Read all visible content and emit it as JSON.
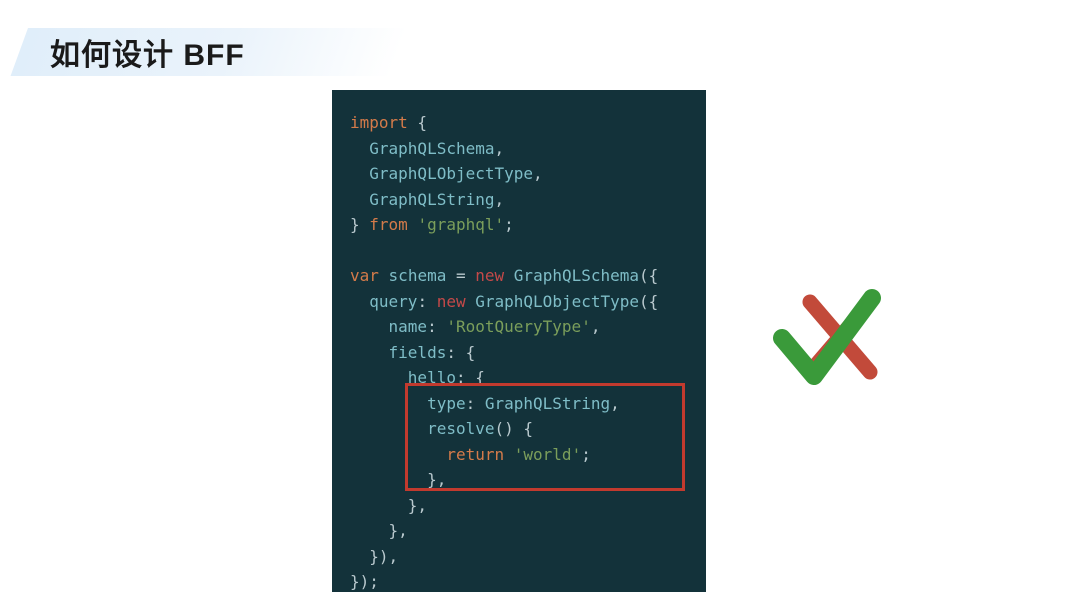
{
  "header": {
    "title": "如何设计 BFF"
  },
  "code": {
    "lines": [
      [
        {
          "t": "import",
          "c": "kw-orange"
        },
        {
          "t": " {",
          "c": "punct"
        }
      ],
      [
        {
          "t": "  GraphQLSchema",
          "c": "ident"
        },
        {
          "t": ",",
          "c": "punct"
        }
      ],
      [
        {
          "t": "  GraphQLObjectType",
          "c": "ident"
        },
        {
          "t": ",",
          "c": "punct"
        }
      ],
      [
        {
          "t": "  GraphQLString",
          "c": "ident"
        },
        {
          "t": ",",
          "c": "punct"
        }
      ],
      [
        {
          "t": "} ",
          "c": "punct"
        },
        {
          "t": "from",
          "c": "kw-orange"
        },
        {
          "t": " ",
          "c": "punct"
        },
        {
          "t": "'graphql'",
          "c": "str"
        },
        {
          "t": ";",
          "c": "punct"
        }
      ],
      [
        {
          "t": "",
          "c": "punct"
        }
      ],
      [
        {
          "t": "var",
          "c": "kw-orange"
        },
        {
          "t": " ",
          "c": "punct"
        },
        {
          "t": "schema",
          "c": "ident"
        },
        {
          "t": " = ",
          "c": "punct"
        },
        {
          "t": "new",
          "c": "kw-red"
        },
        {
          "t": " ",
          "c": "punct"
        },
        {
          "t": "GraphQLSchema",
          "c": "ident"
        },
        {
          "t": "({",
          "c": "punct"
        }
      ],
      [
        {
          "t": "  query",
          "c": "ident"
        },
        {
          "t": ": ",
          "c": "punct"
        },
        {
          "t": "new",
          "c": "kw-red"
        },
        {
          "t": " ",
          "c": "punct"
        },
        {
          "t": "GraphQLObjectType",
          "c": "ident"
        },
        {
          "t": "({",
          "c": "punct"
        }
      ],
      [
        {
          "t": "    name",
          "c": "ident"
        },
        {
          "t": ": ",
          "c": "punct"
        },
        {
          "t": "'RootQueryType'",
          "c": "str"
        },
        {
          "t": ",",
          "c": "punct"
        }
      ],
      [
        {
          "t": "    fields",
          "c": "ident"
        },
        {
          "t": ": {",
          "c": "punct"
        }
      ],
      [
        {
          "t": "      hello",
          "c": "ident"
        },
        {
          "t": ": {",
          "c": "punct"
        }
      ],
      [
        {
          "t": "        type",
          "c": "ident"
        },
        {
          "t": ": ",
          "c": "punct"
        },
        {
          "t": "GraphQLString",
          "c": "ident"
        },
        {
          "t": ",",
          "c": "punct"
        }
      ],
      [
        {
          "t": "        ",
          "c": "punct"
        },
        {
          "t": "resolve",
          "c": "ident"
        },
        {
          "t": "() {",
          "c": "punct"
        }
      ],
      [
        {
          "t": "          ",
          "c": "punct"
        },
        {
          "t": "return",
          "c": "kw-orange"
        },
        {
          "t": " ",
          "c": "punct"
        },
        {
          "t": "'world'",
          "c": "str"
        },
        {
          "t": ";",
          "c": "punct"
        }
      ],
      [
        {
          "t": "        },",
          "c": "punct"
        }
      ],
      [
        {
          "t": "      },",
          "c": "punct"
        }
      ],
      [
        {
          "t": "    },",
          "c": "punct"
        }
      ],
      [
        {
          "t": "  }),",
          "c": "punct"
        }
      ],
      [
        {
          "t": "});",
          "c": "punct"
        }
      ]
    ]
  },
  "marks": {
    "check_color": "#3a9a3a",
    "cross_color": "#c24a3a"
  }
}
